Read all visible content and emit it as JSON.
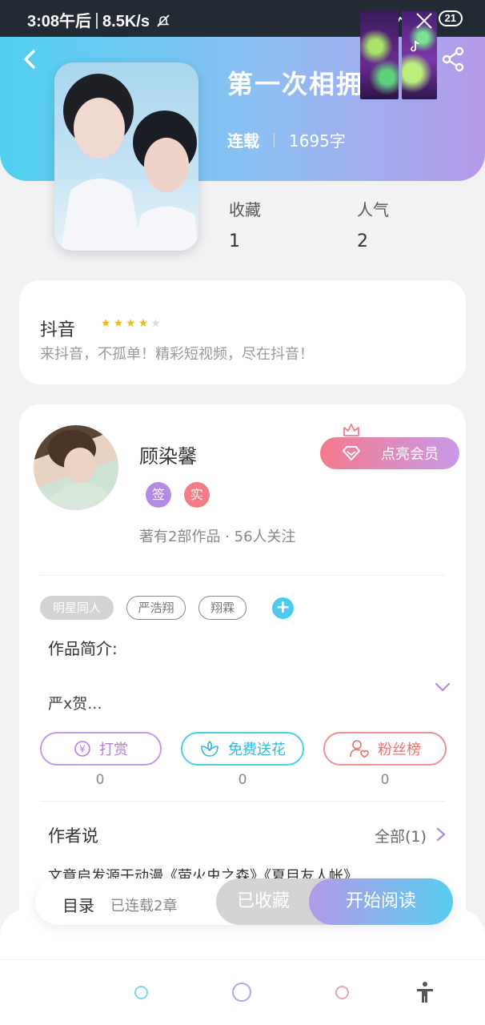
{
  "status_bar": {
    "time": "3:08午后",
    "speed": "8.5K/s",
    "battery": "21"
  },
  "book": {
    "title": "第一次相拥",
    "status": "连载",
    "word_count": "1695字",
    "favorites_label": "收藏",
    "favorites_value": "1",
    "popularity_label": "人气",
    "popularity_value": "2"
  },
  "ad": {
    "name": "抖音",
    "rating_stars": 4,
    "rating_max": 5,
    "description": "来抖音，不孤单！精彩短视频，尽在抖音！"
  },
  "author": {
    "name": "顾染馨",
    "badge_sign": "签",
    "badge_real": "实",
    "stats": "著有2部作品 · 56人关注",
    "vip_button": "点亮会员"
  },
  "tags": [
    "明星同人",
    "严浩翔",
    "翔霖"
  ],
  "intro": {
    "label": "作品简介:",
    "text": "严x贺..."
  },
  "actions": {
    "reward": {
      "label": "打赏",
      "count": "0"
    },
    "flower": {
      "label": "免费送花",
      "count": "0"
    },
    "fans": {
      "label": "粉丝榜",
      "count": "0"
    }
  },
  "author_says": {
    "title": "作者说",
    "view_all": "全部(1)",
    "note": "文章启发源于动漫《萤火虫之森》《夏目友人帐》"
  },
  "bottom_bar": {
    "catalog": "目录",
    "catalog_status": "已连载2章",
    "collected": "已收藏",
    "start_reading": "开始阅读"
  },
  "colors": {
    "hero_start": "#4fd1f1",
    "hero_end": "#b59ae8",
    "accent_blue": "#4cc9ef",
    "accent_purple": "#b48be3",
    "accent_red": "#f17e87"
  }
}
